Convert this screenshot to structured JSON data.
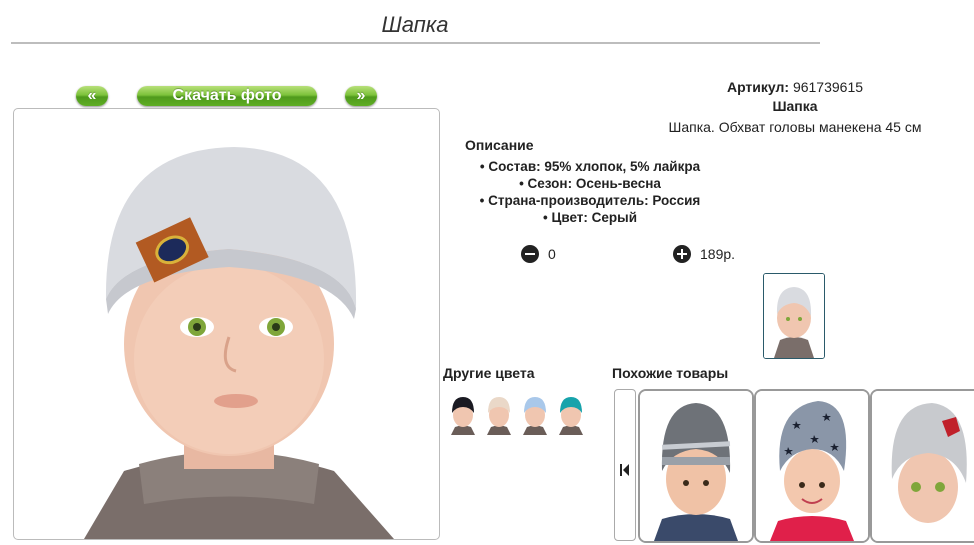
{
  "page": {
    "title": "Шапка"
  },
  "gallery": {
    "prev_label": "«",
    "download_label": "Скачать фото",
    "next_label": "»"
  },
  "product": {
    "article_label": "Артикул:",
    "article_value": "961739615",
    "name": "Шапка",
    "short_description": "Шапка. Обхват головы манекена 45 см"
  },
  "description": {
    "heading": "Описание",
    "items": [
      "Состав: 95% хлопок, 5% лайкра",
      "Сезон: Осень-весна",
      "Страна-производитель: Россия",
      "Цвет: Серый"
    ]
  },
  "cart": {
    "quantity": "0",
    "price": "189р."
  },
  "other_colors": {
    "heading": "Другие цвета",
    "swatches": [
      "black-hat",
      "beige-hat",
      "light-blue-hat",
      "teal-hat"
    ]
  },
  "similar": {
    "heading": "Похожие товары",
    "nav_icon": "first-page-icon"
  },
  "colors": {
    "accent_green": "#6ab82c",
    "hat_grey": "#d9dbe0"
  }
}
